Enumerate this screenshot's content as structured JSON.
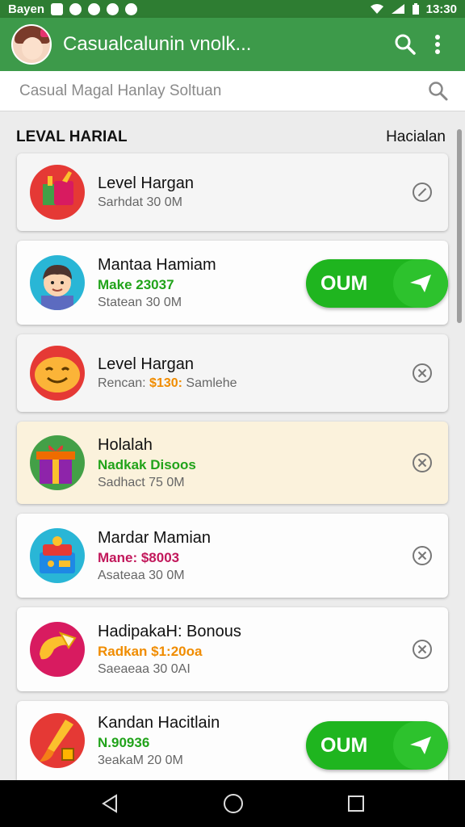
{
  "status_bar": {
    "carrier": "Bayen",
    "time": "13:30"
  },
  "app_bar": {
    "title": "Casualcalunin vnolk..."
  },
  "search": {
    "placeholder": "Casual Magal Hanlay Soltuan"
  },
  "section": {
    "title": "LEVAL HARIAL",
    "action": "Hacialan"
  },
  "items": [
    {
      "title": "Level Hargan",
      "meta": "Sarhdat 30 0M",
      "icon": "gift-bag-icon",
      "action": "close"
    },
    {
      "title": "Mantaa Hamiam",
      "subtitle": "Make 23037",
      "subtitle_color": "#21a31a",
      "meta": "Statean 30 0M",
      "icon": "boy-avatar-icon",
      "action": "go",
      "button_label": "OUM"
    },
    {
      "title": "Level Hargan",
      "subtitle": "Rencan: ",
      "subtitle_value": "$130:",
      "subtitle_suffix": " Samlehe",
      "meta": "",
      "icon": "smile-icon",
      "action": "close"
    },
    {
      "title": "Holalah",
      "subtitle": "Nadkak Disoos",
      "subtitle_color": "#21a31a",
      "meta": "Sadhact 75 0M",
      "icon": "gift-box-icon",
      "action": "close"
    },
    {
      "title": "Mardar Mamian",
      "subtitle": "Mane: $8003",
      "subtitle_color": "#c2185b",
      "meta": "Asateaa 30 0M",
      "icon": "treasure-chest-icon",
      "action": "close"
    },
    {
      "title": "HadipakaH: Bonous",
      "subtitle": "Radkan $1:20oa",
      "subtitle_color": "#f08c00",
      "meta": "Saeaeaa 30 0AI",
      "icon": "fortune-cookie-icon",
      "action": "close"
    },
    {
      "title": "Kandan Hacitlain",
      "subtitle": "N.90936",
      "subtitle_color": "#21a31a",
      "meta": "3eakaM 20 0M",
      "icon": "paint-brush-icon",
      "action": "go",
      "button_label": "OUM"
    }
  ],
  "colors": {
    "appbar": "#3d9a4a",
    "statusbar": "#2e7d32",
    "go_button": "#1fb51f"
  }
}
